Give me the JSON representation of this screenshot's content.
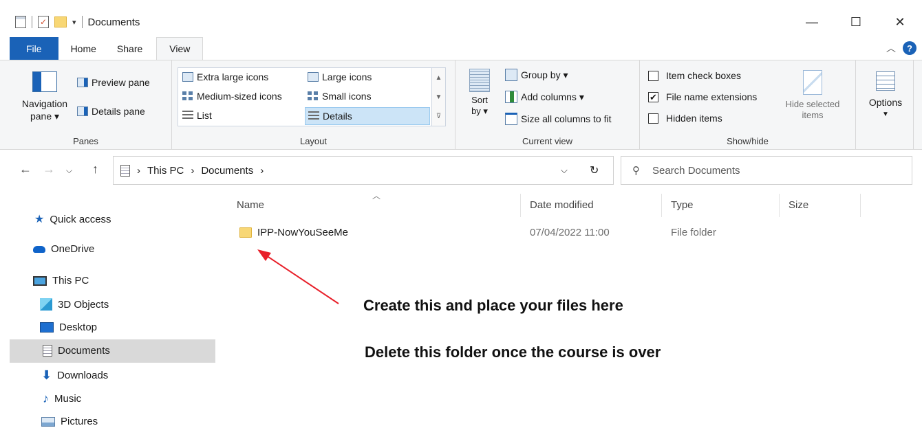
{
  "window": {
    "title": "Documents",
    "minimize_glyph": "—",
    "maximize_glyph": "☐",
    "close_glyph": "✕"
  },
  "tabs": [
    {
      "label": "File"
    },
    {
      "label": "Home"
    },
    {
      "label": "Share"
    },
    {
      "label": "View"
    }
  ],
  "ribbon": {
    "panes": {
      "group_label": "Panes",
      "navigation_pane": "Navigation\npane ▾",
      "preview_pane": "Preview pane",
      "details_pane": "Details pane"
    },
    "layout": {
      "group_label": "Layout",
      "options": [
        "Extra large icons",
        "Large icons",
        "Medium-sized icons",
        "Small icons",
        "List",
        "Details"
      ],
      "selected": "Details"
    },
    "current_view": {
      "group_label": "Current view",
      "sort_by": "Sort\nby ▾",
      "group_by": "Group by ▾",
      "add_columns": "Add columns ▾",
      "size_columns": "Size all columns to fit"
    },
    "show_hide": {
      "group_label": "Show/hide",
      "item_check_boxes": "Item check boxes",
      "file_name_extensions": "File name extensions",
      "hidden_items": "Hidden items",
      "hide_selected": "Hide selected\nitems",
      "checks": {
        "item_check_boxes": false,
        "file_name_extensions": true,
        "hidden_items": false
      }
    },
    "options": {
      "label": "Options"
    }
  },
  "address": {
    "path": [
      "This PC",
      "Documents"
    ],
    "search_placeholder": "Search Documents"
  },
  "nav_pane": {
    "items": [
      {
        "label": "Quick access",
        "icon": "star-icon"
      },
      {
        "label": "OneDrive",
        "icon": "cloud-icon"
      },
      {
        "label": "This PC",
        "icon": "computer-icon"
      },
      {
        "label": "3D Objects",
        "icon": "cube-icon"
      },
      {
        "label": "Desktop",
        "icon": "desktop-icon"
      },
      {
        "label": "Documents",
        "icon": "document-icon"
      },
      {
        "label": "Downloads",
        "icon": "download-icon"
      },
      {
        "label": "Music",
        "icon": "music-icon"
      },
      {
        "label": "Pictures",
        "icon": "picture-icon"
      }
    ],
    "selected": "Documents"
  },
  "file_list": {
    "columns": [
      "Name",
      "Date modified",
      "Type",
      "Size"
    ],
    "rows": [
      {
        "name": "IPP-NowYouSeeMe",
        "date_modified": "07/04/2022 11:00",
        "type": "File folder",
        "size": ""
      }
    ]
  },
  "annotations": {
    "line1": "Create this and place your files here",
    "line2": "Delete this folder once the course is over",
    "arrow_color": "#e8202a"
  },
  "colors": {
    "accent": "#1a62b7",
    "selection": "#cce4f7",
    "nav_selection": "#d9d9d9"
  }
}
